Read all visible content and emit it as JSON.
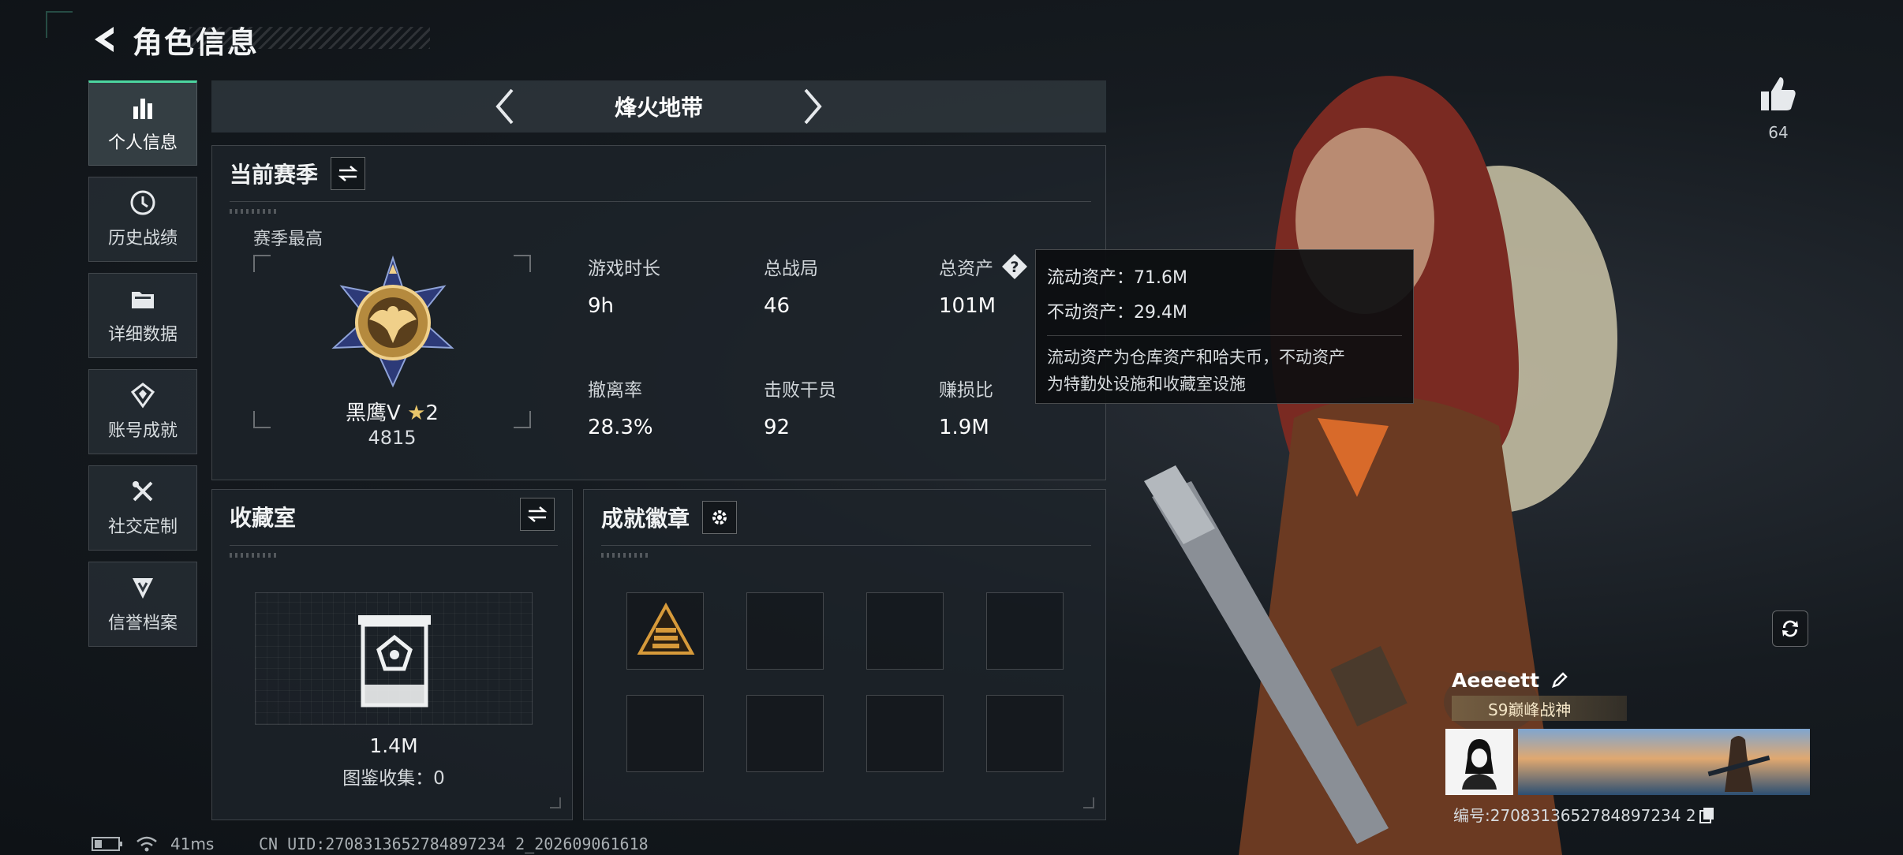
{
  "header": {
    "title": "角色信息"
  },
  "sidebar": {
    "items": [
      {
        "label": "个人信息",
        "icon": "bar-chart-icon",
        "active": true
      },
      {
        "label": "历史战绩",
        "icon": "history-clock-icon",
        "active": false
      },
      {
        "label": "详细数据",
        "icon": "folder-icon",
        "active": false
      },
      {
        "label": "账号成就",
        "icon": "achievement-icon",
        "active": false
      },
      {
        "label": "社交定制",
        "icon": "tools-icon",
        "active": false
      },
      {
        "label": "信誉档案",
        "icon": "credit-shield-icon",
        "active": false
      }
    ]
  },
  "mode": {
    "name": "烽火地带"
  },
  "season": {
    "title": "当前赛季",
    "subtitle": "赛季最高",
    "rank_name": "黑鹰V",
    "rank_stars": "2",
    "rank_score": "4815",
    "stats": [
      {
        "label": "游戏时长",
        "value": "9h"
      },
      {
        "label": "总战局",
        "value": "46"
      },
      {
        "label": "总资产",
        "value": "101M"
      },
      {
        "label": "撤离率",
        "value": "28.3%"
      },
      {
        "label": "击败干员",
        "value": "92"
      },
      {
        "label": "赚损比",
        "value": "1.9M"
      }
    ]
  },
  "tooltip": {
    "line1": "流动资产：71.6M",
    "line2": "不动资产：29.4M",
    "desc1": "流动资产为仓库资产和哈夫币，不动资产",
    "desc2": "为特勤处设施和收藏室设施"
  },
  "collection": {
    "title": "收藏室",
    "value": "1.4M",
    "sub": "图鉴收集：0"
  },
  "badges": {
    "title": "成就徽章"
  },
  "like": {
    "count": "64"
  },
  "card": {
    "name": "Aeeeett",
    "title": "S9巅峰战神",
    "uid": "编号:2708313652784897234 2"
  },
  "footer": {
    "latency": "41ms",
    "cn_uid": "CN UID:2708313652784897234 2_202609061618"
  },
  "colors": {
    "accent": "#4cd6a0",
    "panel_bg": "#1e242a",
    "tooltip_bg": "#0c0e10"
  }
}
